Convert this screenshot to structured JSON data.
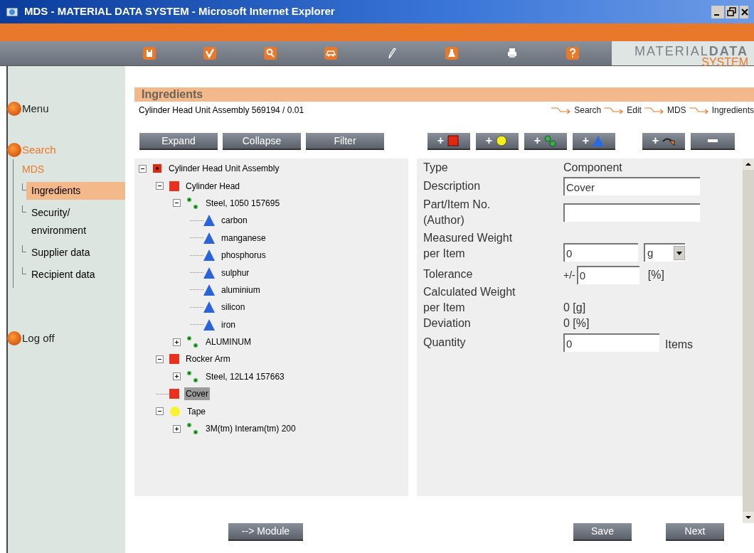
{
  "window": {
    "title": "MDS - MATERIAL DATA SYSTEM - Microsoft Internet Explorer"
  },
  "toolbar": [
    {
      "kind": "save"
    },
    {
      "kind": "check"
    },
    {
      "kind": "search"
    },
    {
      "kind": "car"
    },
    {
      "kind": "pencil"
    },
    {
      "kind": "flask"
    },
    {
      "kind": "printer"
    },
    {
      "kind": "help"
    }
  ],
  "logo": {
    "title": "MATERIAL**DATA**",
    "subtitle": "SYSTEM"
  },
  "sidebar": {
    "items": [
      {
        "label": "Menu",
        "selected": false
      },
      {
        "label": "Search",
        "selected": true,
        "children": [
          {
            "label": "MDS",
            "selected": true,
            "children": [
              {
                "label": "Ingredients",
                "selected": true
              },
              {
                "label": "Security/\nenvironment",
                "selected": false
              },
              {
                "label": "Supplier data",
                "selected": false
              },
              {
                "label": "Recipient data",
                "selected": false
              }
            ]
          }
        ]
      },
      {
        "label": "Log off",
        "selected": false
      }
    ]
  },
  "header": {
    "title": "Ingredients",
    "subtitle": "Cylinder Head Unit Assembly 569194 / 0.01",
    "breadcrumb": [
      "Search",
      "Edit",
      "MDS",
      "Ingredients"
    ]
  },
  "tree_buttons": [
    "Expand",
    "Collapse",
    "Filter"
  ],
  "action_buttons": [
    {
      "kind": "add-component",
      "label": "+"
    },
    {
      "kind": "add-semi",
      "label": "+"
    },
    {
      "kind": "add-material",
      "label": "+"
    },
    {
      "kind": "add-substance",
      "label": "+"
    },
    {
      "kind": "add-link",
      "label": "+"
    },
    {
      "kind": "remove"
    }
  ],
  "tree": {
    "nodes": [
      {
        "label": "Cylinder Head Unit Assembly",
        "kind": "assembly",
        "expanded": true,
        "selected": false,
        "children": [
          {
            "label": "Cylinder Head",
            "kind": "component",
            "expanded": true,
            "selected": false,
            "children": [
              {
                "label": "Steel, 1050 157695",
                "kind": "material",
                "expanded": true,
                "selected": false,
                "children": [
                  {
                    "label": "carbon",
                    "kind": "substance",
                    "selected": false
                  },
                  {
                    "label": "manganese",
                    "kind": "substance",
                    "selected": false
                  },
                  {
                    "label": "phosphorus",
                    "kind": "substance",
                    "selected": false
                  },
                  {
                    "label": "sulphur",
                    "kind": "substance",
                    "selected": false
                  },
                  {
                    "label": "aluminium",
                    "kind": "substance",
                    "selected": false
                  },
                  {
                    "label": "silicon",
                    "kind": "substance",
                    "selected": false
                  },
                  {
                    "label": "iron",
                    "kind": "substance",
                    "selected": false
                  }
                ]
              },
              {
                "label": "ALUMINUM",
                "kind": "material",
                "expanded": false,
                "selected": false
              }
            ]
          },
          {
            "label": "Rocker Arm",
            "kind": "component",
            "expanded": true,
            "selected": false,
            "children": [
              {
                "label": "Steel, 12L14 157663",
                "kind": "material",
                "expanded": false,
                "selected": false
              }
            ]
          },
          {
            "label": "Cover",
            "kind": "component",
            "selected": true
          },
          {
            "label": "Tape",
            "kind": "semi",
            "expanded": true,
            "selected": false,
            "children": [
              {
                "label": "3M(tm) Interam(tm) 200",
                "kind": "material",
                "expanded": false,
                "selected": false
              }
            ]
          }
        ]
      }
    ]
  },
  "form": [
    {
      "kind": "value",
      "label": "Type",
      "value": "Component"
    },
    {
      "kind": "input",
      "label": "Description",
      "value": "Cover"
    },
    {
      "kind": "input",
      "label": "Part/Item No.\n(Author)"
    },
    {
      "kind": "weight",
      "label": "Measured Weight\nper Item",
      "value": "0",
      "unit": "g"
    },
    {
      "kind": "tolerance",
      "label": "Tolerance",
      "prefix": "+/-",
      "value": "0",
      "suffix": "[%]"
    },
    {
      "kind": "value",
      "label": "Calculated Weight\nper Item",
      "value": "0 [g]"
    },
    {
      "kind": "value",
      "label": "Deviation",
      "value": "0 [%]"
    },
    {
      "kind": "quantity",
      "label": "Quantity",
      "value": "0",
      "suffix": "Items"
    }
  ],
  "bottom_buttons": {
    "left": "--> Module",
    "right": [
      "Save",
      "Next"
    ]
  }
}
